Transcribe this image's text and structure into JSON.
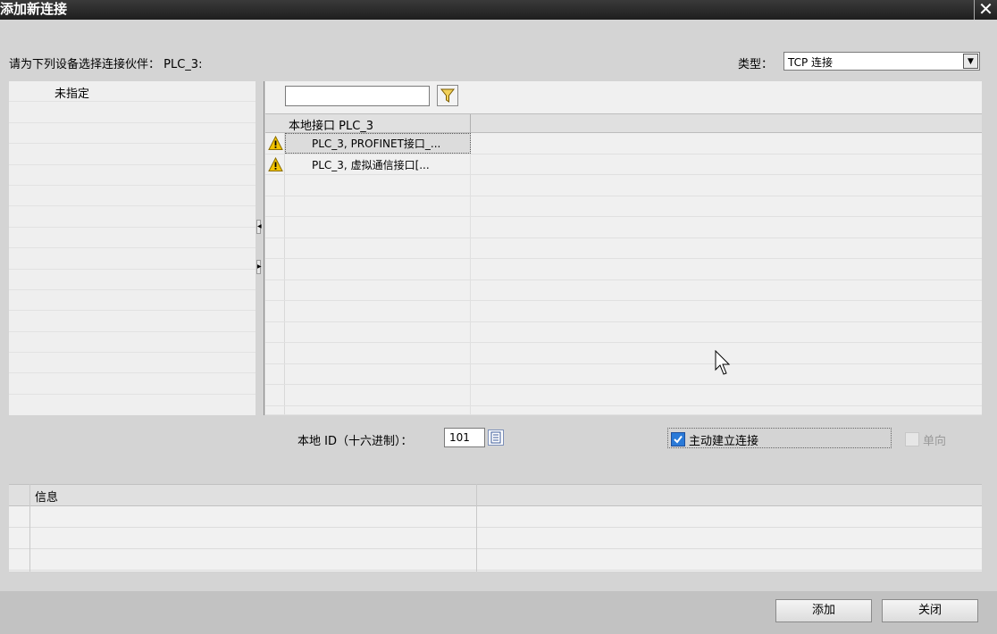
{
  "dialog": {
    "title": "添加新连接",
    "close_label": "✕"
  },
  "prompt": "请为下列设备选择连接伙伴： PLC_3:",
  "type_field": {
    "label": "类型：",
    "value": "TCP 连接"
  },
  "left_list": {
    "items": [
      "未指定"
    ]
  },
  "right_panel": {
    "filter_value": "",
    "column_header": "本地接口 PLC_3",
    "rows": [
      {
        "name": "PLC_3, PROFINET接口_...",
        "status_icon": "warning-icon"
      },
      {
        "name": "PLC_3, 虚拟通信接口[...",
        "status_icon": "warning-icon"
      }
    ]
  },
  "local_id": {
    "label": "本地 ID（十六进制）：",
    "value": "101"
  },
  "active_connection": {
    "label": "主动建立连接",
    "checked": true
  },
  "one_way": {
    "label": "单向",
    "checked": false,
    "enabled": false
  },
  "info": {
    "header": "信息"
  },
  "buttons": {
    "add": "添加",
    "close": "关闭"
  },
  "colors": {
    "title_bar": "#1e1e1e",
    "dialog_bg": "#d4d4d4",
    "warning": "#f3c400",
    "check": "#1e6fd1"
  }
}
